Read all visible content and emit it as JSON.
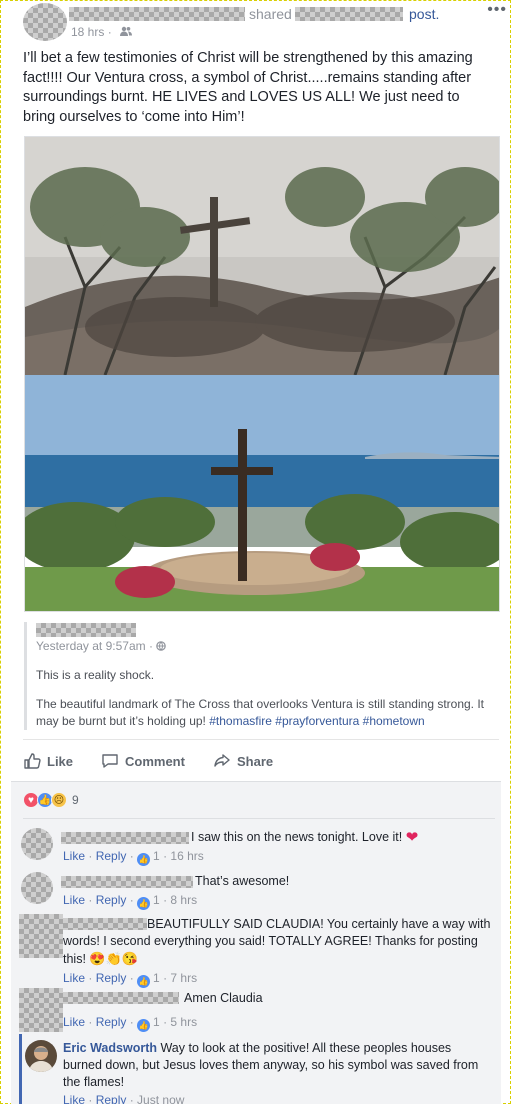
{
  "header": {
    "shared_label": "shared",
    "post_label": "post.",
    "more_label": "•••",
    "time": "18 hrs",
    "audience_icon": "friends-icon"
  },
  "status": {
    "text": "I’ll bet a few testimonies of Christ will be strengthened by this amazing fact!!!! Our Ventura cross, a symbol of Christ.....remains standing after surroundings burnt. HE LIVES and LOVES US ALL! We just need to bring ourselves to ‘come into Him’!"
  },
  "shared_post": {
    "time": "Yesterday at 9:57am · ",
    "globe_icon": "globe-icon",
    "line1": "This is a reality shock.",
    "line2": "The beautiful landmark of The Cross that overlooks Ventura is still standing strong. It may be burnt but it’s holding up! ",
    "tags": "#thomasfire #prayforventura #hometown"
  },
  "actions": {
    "like": "Like",
    "comment": "Comment",
    "share": "Share"
  },
  "reactions": {
    "count": "9"
  },
  "comments": [
    {
      "text": "I saw this on the news tonight. Love it! ",
      "like": "Like",
      "reply": "Reply",
      "likes": "1",
      "time": "16 hrs"
    },
    {
      "text": "That’s awesome!",
      "like": "Like",
      "reply": "Reply",
      "likes": "1",
      "time": "8 hrs"
    },
    {
      "text": "BEAUTIFULLY SAID CLAUDIA! You certainly have a way with words! I second everything you said! TOTALLY AGREE! Thanks for posting this! ",
      "like": "Like",
      "reply": "Reply",
      "likes": "1",
      "time": "7 hrs"
    },
    {
      "text": "Amen Claudia",
      "like": "Like",
      "reply": "Reply",
      "likes": "1",
      "time": "5 hrs"
    }
  ],
  "reply": {
    "author": "Eric Wadsworth",
    "text": " Way to look at the positive! All these peoples houses burned down, but Jesus loves them anyway, so his symbol was saved from the flames!",
    "like": "Like",
    "reply": "Reply",
    "time": "Just now"
  },
  "colors": {
    "link": "#365899",
    "action_link": "#4267b2",
    "muted": "#90949c",
    "comment_bg": "#f2f3f5"
  }
}
